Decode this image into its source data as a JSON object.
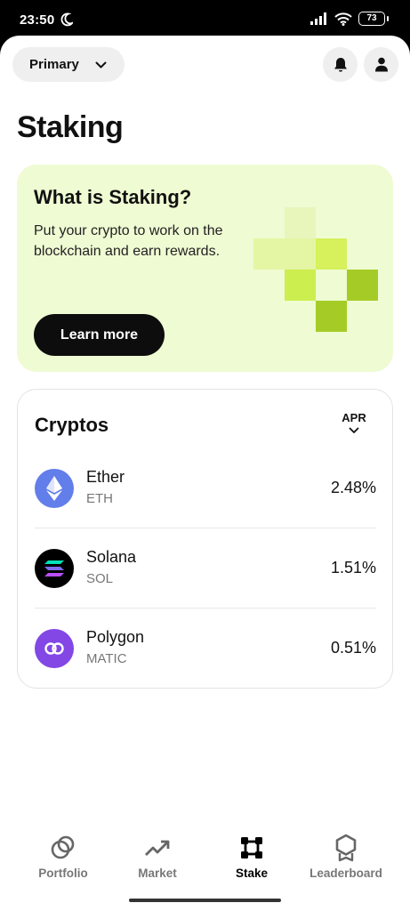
{
  "status_bar": {
    "time": "23:50",
    "battery": "73"
  },
  "header": {
    "account_label": "Primary",
    "title": "Staking"
  },
  "promo": {
    "title": "What is Staking?",
    "description": "Put your crypto to work on the blockchain and earn rewards.",
    "button_label": "Learn more"
  },
  "cryptos": {
    "title": "Cryptos",
    "sort_label": "APR",
    "items": [
      {
        "name": "Ether",
        "symbol": "ETH",
        "apr": "2.48%",
        "icon": "ethereum-icon",
        "color": "#627eea"
      },
      {
        "name": "Solana",
        "symbol": "SOL",
        "apr": "1.51%",
        "icon": "solana-icon",
        "color": "#000000"
      },
      {
        "name": "Polygon",
        "symbol": "MATIC",
        "apr": "0.51%",
        "icon": "polygon-icon",
        "color": "#8247e5"
      }
    ]
  },
  "nav": {
    "items": [
      {
        "label": "Portfolio",
        "icon": "portfolio-icon",
        "active": false
      },
      {
        "label": "Market",
        "icon": "market-trend-icon",
        "active": false
      },
      {
        "label": "Stake",
        "icon": "stake-icon",
        "active": true
      },
      {
        "label": "Leaderboard",
        "icon": "leaderboard-icon",
        "active": false
      }
    ]
  },
  "colors": {
    "promo_bg": "#effbd3",
    "accent_green": "#cdee4f",
    "dark_green": "#a5cc26",
    "button_dark": "#0d0d0d"
  }
}
